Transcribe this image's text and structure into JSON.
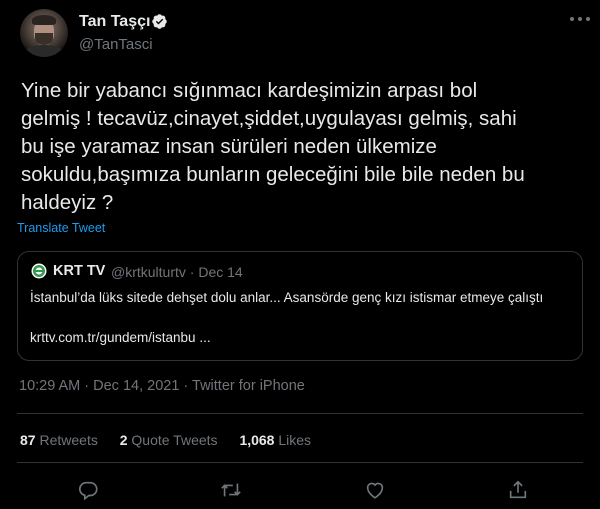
{
  "author": {
    "name": "Tan Taşçı",
    "handle": "@TanTasci"
  },
  "tweet": {
    "text": "Yine bir yabancı sığınmacı kardeşimizin arpası bol\ngelmiş !  tecavüz,cinayet,şiddet,uygulayası gelmiş, sahi\nbu işe yaramaz insan sürüleri neden ülkemize\nsokuldu,başımıza bunların geleceğini bile bile neden bu\nhaldeyiz ?",
    "translate_label": "Translate Tweet"
  },
  "quoted": {
    "name": "KRT TV",
    "handle_date": "@krtkulturtv · Dec 14",
    "text": "İstanbul’da lüks sitede dehşet dolu anlar... Asansörde genç kızı istismar etmeye çalıştı",
    "link": "krttv.com.tr/gundem/istanbu ..."
  },
  "meta": "10:29 AM · Dec 14, 2021 · Twitter for iPhone",
  "stats": {
    "retweets_count": "87",
    "retweets_label": "Retweets",
    "quotes_count": "2",
    "quotes_label": "Quote Tweets",
    "likes_count": "1,068",
    "likes_label": "Likes"
  },
  "colors": {
    "background": "#000000",
    "text": "#e7e9ea",
    "secondary": "#71767b",
    "accent": "#1d9bf0",
    "border": "#2f3336"
  },
  "icons": [
    "verified-badge-icon",
    "more-icon",
    "krt-logo-icon",
    "reply-icon",
    "retweet-icon",
    "like-icon",
    "share-icon"
  ]
}
